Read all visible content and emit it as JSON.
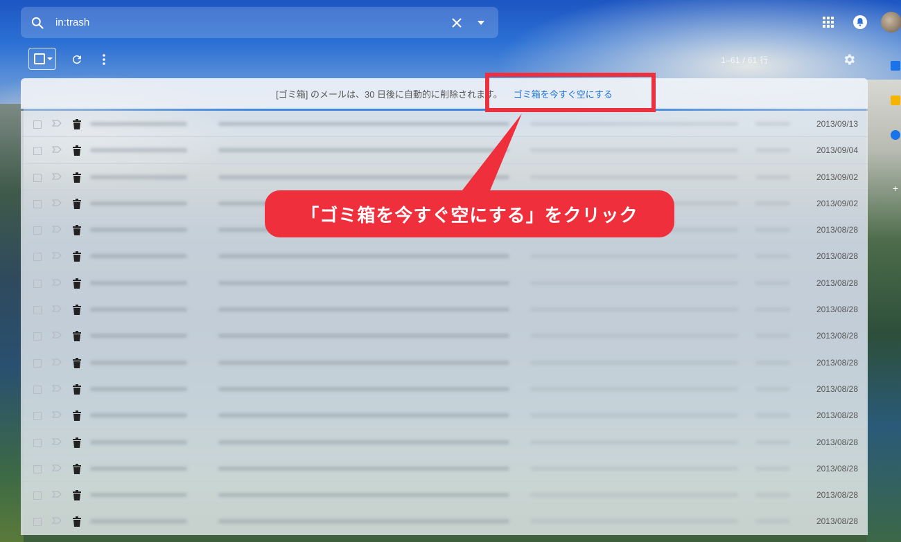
{
  "search": {
    "value": "in:trash"
  },
  "toolbar": {
    "page_count": "1–61 / 61 行"
  },
  "notice": {
    "message": "[ゴミ箱] のメールは、30 日後に自動的に削除されます。",
    "action": "ゴミ箱を今すぐ空にする"
  },
  "callout": {
    "text": "「ゴミ箱を今すぐ空にする」をクリック"
  },
  "colors": {
    "highlight": "#ea3140",
    "callout": "#ef2f3b",
    "link": "#1a6fd4"
  },
  "icons": [
    "search-icon",
    "clear-icon",
    "search-options-icon",
    "apps-grid-icon",
    "notification-icon",
    "refresh-icon",
    "more-vert-icon",
    "settings-gear-icon",
    "checkbox-icon",
    "importance-marker-icon",
    "trash-icon"
  ],
  "emails": [
    {
      "date": "2013/09/13"
    },
    {
      "date": "2013/09/04"
    },
    {
      "date": "2013/09/02"
    },
    {
      "date": "2013/09/02"
    },
    {
      "date": "2013/08/28"
    },
    {
      "date": "2013/08/28"
    },
    {
      "date": "2013/08/28"
    },
    {
      "date": "2013/08/28"
    },
    {
      "date": "2013/08/28"
    },
    {
      "date": "2013/08/28"
    },
    {
      "date": "2013/08/28"
    },
    {
      "date": "2013/08/28"
    },
    {
      "date": "2013/08/28"
    },
    {
      "date": "2013/08/28"
    },
    {
      "date": "2013/08/28"
    },
    {
      "date": "2013/08/28"
    }
  ]
}
